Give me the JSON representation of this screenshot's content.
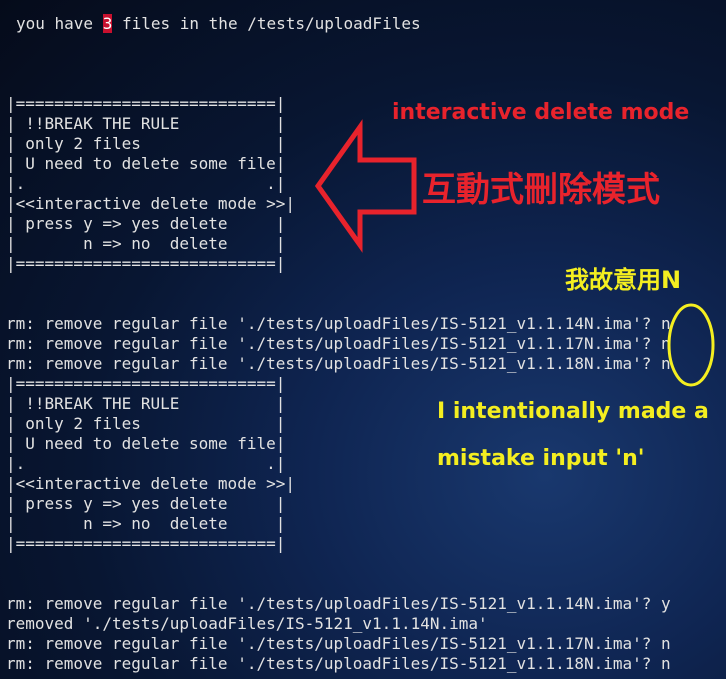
{
  "terminal": {
    "line1_pre": "you have ",
    "line1_count": "3",
    "line1_post": " files in the /tests/uploadFiles",
    "box1": [
      "|===========================|",
      "| !!BREAK THE RULE          |",
      "| only 2 files              |",
      "| U need to delete some file|",
      "|.                         .|",
      "|<<interactive delete mode >>|",
      "| press y => yes delete     |",
      "|       n => no  delete     |",
      "|===========================|"
    ],
    "prompts1": [
      "rm: remove regular file './tests/uploadFiles/IS-5121_v1.1.14N.ima'? n",
      "rm: remove regular file './tests/uploadFiles/IS-5121_v1.1.17N.ima'? n",
      "rm: remove regular file './tests/uploadFiles/IS-5121_v1.1.18N.ima'? n"
    ],
    "box2": [
      "|===========================|",
      "| !!BREAK THE RULE          |",
      "| only 2 files              |",
      "| U need to delete some file|",
      "|.                         .|",
      "|<<interactive delete mode >>|",
      "| press y => yes delete     |",
      "|       n => no  delete     |",
      "|===========================|"
    ],
    "prompts2": [
      "rm: remove regular file './tests/uploadFiles/IS-5121_v1.1.14N.ima'? y",
      "removed './tests/uploadFiles/IS-5121_v1.1.14N.ima'",
      "rm: remove regular file './tests/uploadFiles/IS-5121_v1.1.17N.ima'? n",
      "rm: remove regular file './tests/uploadFiles/IS-5121_v1.1.18N.ima'? n"
    ]
  },
  "annotations": {
    "mode_en": "interactive delete mode",
    "mode_zh": "互動式刪除模式",
    "deliberate_zh": "我故意用N",
    "mistake_line1": "I intentionally made a",
    "mistake_line2": "mistake input 'n'"
  },
  "colors": {
    "terminal_text": "#e2e2e2",
    "count_highlight_bg": "#c8102e",
    "annotation_red": "#e8232c",
    "annotation_yellow": "#f4ee20"
  },
  "icons": {
    "arrow": "arrow-left-outline-icon",
    "circle": "ellipse-outline-icon"
  }
}
